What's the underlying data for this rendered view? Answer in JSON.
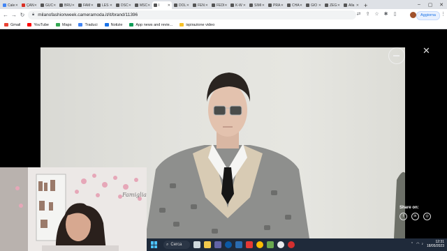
{
  "tabs": [
    {
      "label": "Cale",
      "color": "#4285f4"
    },
    {
      "label": "ÇAN",
      "color": "#d93025"
    },
    {
      "label": "GUC",
      "color": "#555"
    },
    {
      "label": "BRU",
      "color": "#555"
    },
    {
      "label": "FAM",
      "color": "#555"
    },
    {
      "label": "LES",
      "color": "#555"
    },
    {
      "label": "DSC",
      "color": "#555"
    },
    {
      "label": "MSC",
      "color": "#555"
    },
    {
      "label": "I",
      "color": "#555",
      "active": true
    },
    {
      "label": "DOL",
      "color": "#555"
    },
    {
      "label": "FEN",
      "color": "#555"
    },
    {
      "label": "FEDI",
      "color": "#555"
    },
    {
      "label": "K-W",
      "color": "#555"
    },
    {
      "label": "SIMI",
      "color": "#555"
    },
    {
      "label": "PRA",
      "color": "#555"
    },
    {
      "label": "CHA",
      "color": "#555"
    },
    {
      "label": "GIO",
      "color": "#555"
    },
    {
      "label": "ZEG",
      "color": "#555"
    },
    {
      "label": "Alla",
      "color": "#555"
    }
  ],
  "address": {
    "url": "milanofashionweek.cameramoda.it/it/brand/11396"
  },
  "update_label": "Aggiorna",
  "bookmarks": [
    {
      "label": "Gmail",
      "color": "#ea4335"
    },
    {
      "label": "YouTube",
      "color": "#ff0000"
    },
    {
      "label": "Maps",
      "color": "#34a853"
    },
    {
      "label": "Traduci",
      "color": "#4285f4"
    },
    {
      "label": "Notizie",
      "color": "#1a73e8"
    },
    {
      "label": "App news and revie...",
      "color": "#0f9d58"
    },
    {
      "label": "ispirazione video",
      "color": "#f6c026"
    }
  ],
  "share": {
    "label": "Share on:",
    "icons": [
      "f",
      "in",
      "◎"
    ]
  },
  "webcam": {
    "sign": "Famiglia"
  },
  "taskbar": {
    "search_label": "Cerca",
    "time": "12:31",
    "date": "18/05/2023"
  },
  "colors": {
    "accent": "#1a73e8",
    "taskbar": "#1f2a3a"
  }
}
